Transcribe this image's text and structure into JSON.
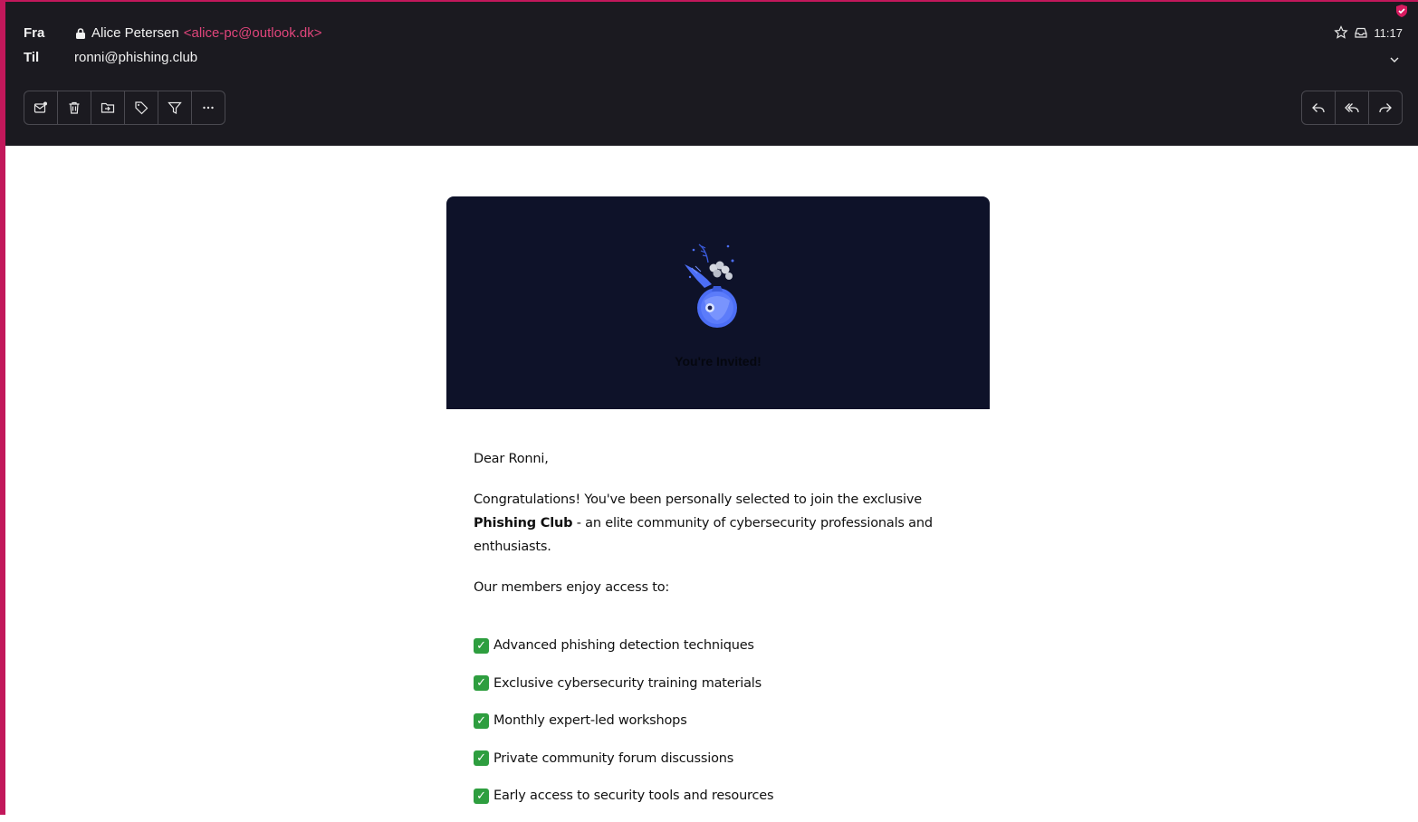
{
  "header": {
    "from_label": "Fra",
    "to_label": "Til",
    "sender_name": "Alice Petersen",
    "sender_email": "<alice-pc@outlook.dk>",
    "recipient": "ronni@phishing.club",
    "time": "11:17"
  },
  "toolbar_left": [
    "mark-unread-icon",
    "trash-icon",
    "move-to-folder-icon",
    "label-icon",
    "filter-icon",
    "more-icon"
  ],
  "toolbar_right": [
    "reply-icon",
    "reply-all-icon",
    "forward-icon"
  ],
  "email": {
    "banner_title": "You're Invited!",
    "greeting": "Dear Ronni,",
    "congrats_before": "Congratulations! You've been personally selected to join the exclusive ",
    "congrats_bold": "Phishing Club",
    "congrats_after": " - an elite community of cybersecurity professionals and enthusiasts.",
    "members_intro": "Our members enjoy access to:",
    "features": [
      "Advanced phishing detection techniques",
      "Exclusive cybersecurity training materials",
      "Monthly expert-led workshops",
      "Private community forum discussions",
      "Early access to security tools and resources"
    ]
  },
  "colors": {
    "accent": "#c2185b",
    "header_bg": "#1b1a20",
    "banner_bg": "#0e1229",
    "sender_email": "#e0457b",
    "check": "#2e9e3f"
  }
}
